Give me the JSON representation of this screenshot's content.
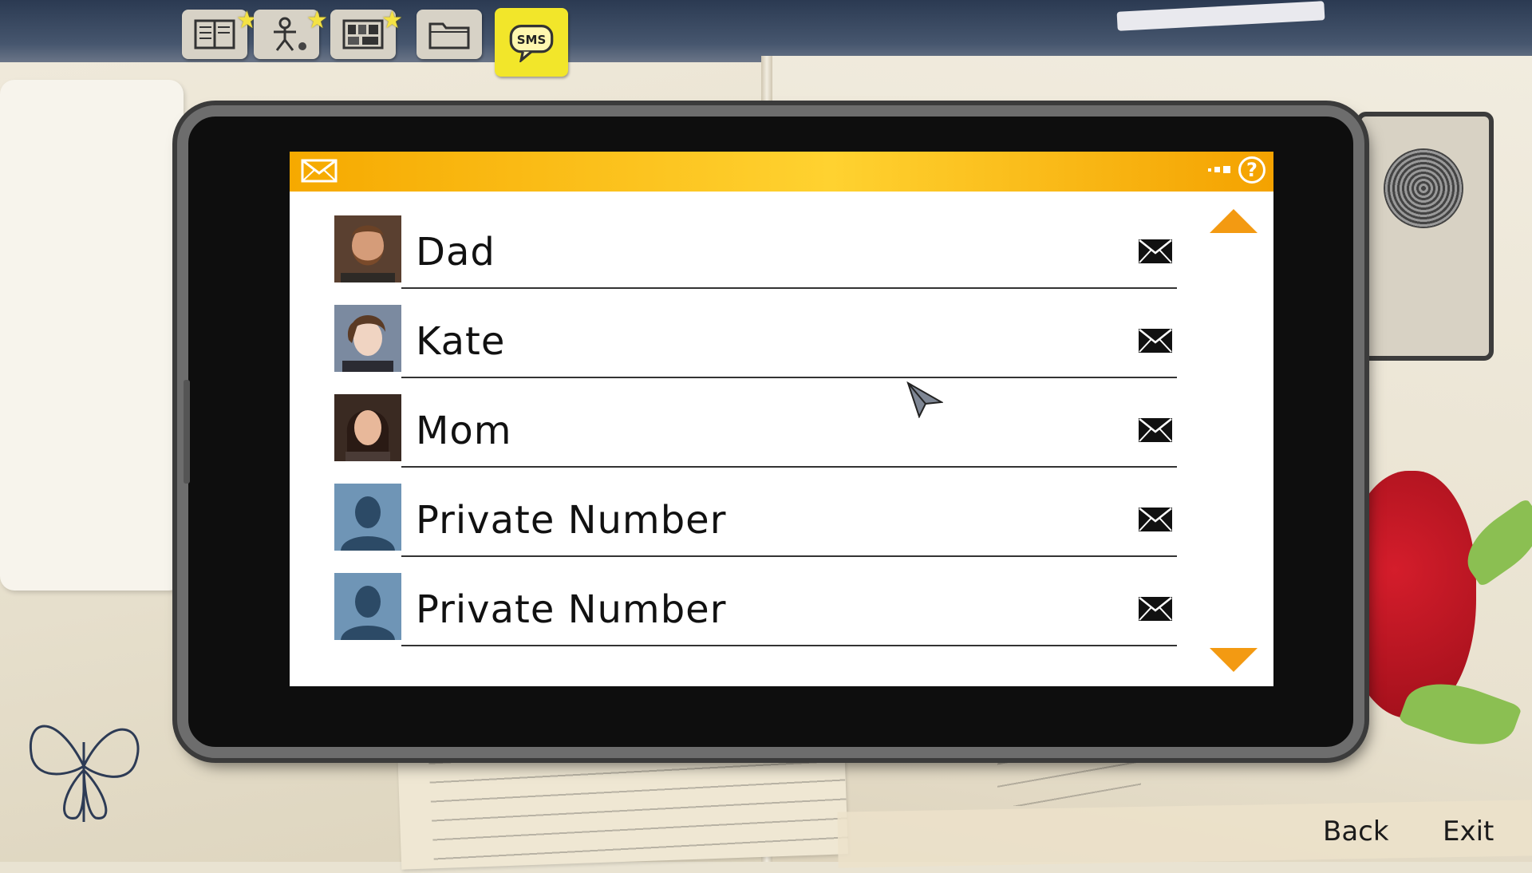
{
  "tabs": [
    {
      "id": "journal",
      "icon": "journal-icon"
    },
    {
      "id": "characters",
      "icon": "stick-figure-icon"
    },
    {
      "id": "collectibles",
      "icon": "photo-wall-icon"
    },
    {
      "id": "documents",
      "icon": "folder-icon"
    },
    {
      "id": "sms",
      "icon": "sms-bubble-icon",
      "label": "SMS",
      "active": true
    }
  ],
  "phone": {
    "header": {
      "icon": "envelope-icon",
      "help_label": "?"
    },
    "contacts": [
      {
        "name": "Dad",
        "avatar": "dad-portrait"
      },
      {
        "name": "Kate",
        "avatar": "kate-portrait"
      },
      {
        "name": "Mom",
        "avatar": "mom-portrait"
      },
      {
        "name": "Private Number",
        "avatar": "silhouette"
      },
      {
        "name": "Private Number",
        "avatar": "silhouette"
      }
    ]
  },
  "footer": {
    "back_label": "Back",
    "exit_label": "Exit"
  },
  "colors": {
    "header_orange": "#f6a900",
    "header_yellow": "#ffd230",
    "scroll_arrow": "#f39a12",
    "sms_tab": "#f2e62a"
  }
}
